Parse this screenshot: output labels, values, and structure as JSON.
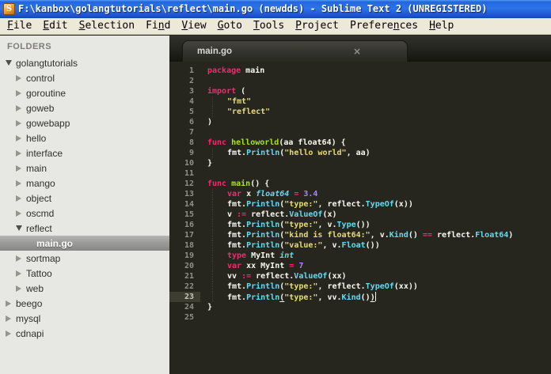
{
  "window": {
    "title": "F:\\kanbox\\golangtutorials\\reflect\\main.go (newdds) - Sublime Text 2 (UNREGISTERED)"
  },
  "menu": {
    "items": [
      {
        "label": "File",
        "underline": 0
      },
      {
        "label": "Edit",
        "underline": 0
      },
      {
        "label": "Selection",
        "underline": 0
      },
      {
        "label": "Find",
        "underline": 2
      },
      {
        "label": "View",
        "underline": 0
      },
      {
        "label": "Goto",
        "underline": 0
      },
      {
        "label": "Tools",
        "underline": 0
      },
      {
        "label": "Project",
        "underline": 0
      },
      {
        "label": "Preferences",
        "underline": 7
      },
      {
        "label": "Help",
        "underline": 0
      }
    ]
  },
  "sidebar": {
    "header": "FOLDERS",
    "tree": [
      {
        "label": "golangtutorials",
        "level": 0,
        "state": "open",
        "selected": false
      },
      {
        "label": "control",
        "level": 1,
        "state": "closed",
        "selected": false
      },
      {
        "label": "goroutine",
        "level": 1,
        "state": "closed",
        "selected": false
      },
      {
        "label": "goweb",
        "level": 1,
        "state": "closed",
        "selected": false
      },
      {
        "label": "gowebapp",
        "level": 1,
        "state": "closed",
        "selected": false
      },
      {
        "label": "hello",
        "level": 1,
        "state": "closed",
        "selected": false
      },
      {
        "label": "interface",
        "level": 1,
        "state": "closed",
        "selected": false
      },
      {
        "label": "main",
        "level": 1,
        "state": "closed",
        "selected": false
      },
      {
        "label": "mango",
        "level": 1,
        "state": "closed",
        "selected": false
      },
      {
        "label": "object",
        "level": 1,
        "state": "closed",
        "selected": false
      },
      {
        "label": "oscmd",
        "level": 1,
        "state": "closed",
        "selected": false
      },
      {
        "label": "reflect",
        "level": 1,
        "state": "open",
        "selected": false
      },
      {
        "label": "main.go",
        "level": 2,
        "state": "file",
        "selected": true
      },
      {
        "label": "sortmap",
        "level": 1,
        "state": "closed",
        "selected": false
      },
      {
        "label": "Tattoo",
        "level": 1,
        "state": "closed",
        "selected": false
      },
      {
        "label": "web",
        "level": 1,
        "state": "closed",
        "selected": false
      },
      {
        "label": "beego",
        "level": 0,
        "state": "closed",
        "selected": false
      },
      {
        "label": "mysql",
        "level": 0,
        "state": "closed",
        "selected": false
      },
      {
        "label": "cdnapi",
        "level": 0,
        "state": "closed",
        "selected": false
      }
    ]
  },
  "tab": {
    "label": "main.go",
    "close": "×"
  },
  "editor": {
    "active_line": 23,
    "lines": [
      {
        "num": 1,
        "ind": 0,
        "tokens": [
          [
            "k",
            "package"
          ],
          [
            "w",
            " main"
          ]
        ]
      },
      {
        "num": 2,
        "ind": 0,
        "tokens": []
      },
      {
        "num": 3,
        "ind": 0,
        "tokens": [
          [
            "k",
            "import"
          ],
          [
            "w",
            " ("
          ]
        ]
      },
      {
        "num": 4,
        "ind": 1,
        "tokens": [
          [
            "s",
            "\"fmt\""
          ]
        ]
      },
      {
        "num": 5,
        "ind": 1,
        "tokens": [
          [
            "s",
            "\"reflect\""
          ]
        ]
      },
      {
        "num": 6,
        "ind": 0,
        "tokens": [
          [
            "w",
            ")"
          ]
        ]
      },
      {
        "num": 7,
        "ind": 0,
        "tokens": []
      },
      {
        "num": 8,
        "ind": 0,
        "tokens": [
          [
            "k",
            "func"
          ],
          [
            "w",
            " "
          ],
          [
            "g",
            "helloworld"
          ],
          [
            "w",
            "(aa float64) {"
          ]
        ]
      },
      {
        "num": 9,
        "ind": 1,
        "tokens": [
          [
            "w",
            "fmt."
          ],
          [
            "c",
            "Println"
          ],
          [
            "w",
            "("
          ],
          [
            "s",
            "\"hello world\""
          ],
          [
            "w",
            ", aa)"
          ]
        ]
      },
      {
        "num": 10,
        "ind": 0,
        "tokens": [
          [
            "w",
            "}"
          ]
        ]
      },
      {
        "num": 11,
        "ind": 0,
        "tokens": []
      },
      {
        "num": 12,
        "ind": 0,
        "tokens": [
          [
            "k",
            "func"
          ],
          [
            "w",
            " "
          ],
          [
            "g",
            "main"
          ],
          [
            "w",
            "() {"
          ]
        ]
      },
      {
        "num": 13,
        "ind": 1,
        "tokens": [
          [
            "k",
            "var"
          ],
          [
            "w",
            " x "
          ],
          [
            "t",
            "float64"
          ],
          [
            "w",
            " "
          ],
          [
            "k",
            "="
          ],
          [
            "w",
            " "
          ],
          [
            "n",
            "3.4"
          ]
        ]
      },
      {
        "num": 14,
        "ind": 1,
        "tokens": [
          [
            "w",
            "fmt."
          ],
          [
            "c",
            "Println"
          ],
          [
            "w",
            "("
          ],
          [
            "s",
            "\"type:\""
          ],
          [
            "w",
            ", reflect."
          ],
          [
            "c",
            "TypeOf"
          ],
          [
            "w",
            "(x))"
          ]
        ]
      },
      {
        "num": 15,
        "ind": 1,
        "tokens": [
          [
            "w",
            "v "
          ],
          [
            "k",
            ":="
          ],
          [
            "w",
            " reflect."
          ],
          [
            "c",
            "ValueOf"
          ],
          [
            "w",
            "(x)"
          ]
        ]
      },
      {
        "num": 16,
        "ind": 1,
        "tokens": [
          [
            "w",
            "fmt."
          ],
          [
            "c",
            "Println"
          ],
          [
            "w",
            "("
          ],
          [
            "s",
            "\"type:\""
          ],
          [
            "w",
            ", v."
          ],
          [
            "c",
            "Type"
          ],
          [
            "w",
            "())"
          ]
        ]
      },
      {
        "num": 17,
        "ind": 1,
        "tokens": [
          [
            "w",
            "fmt."
          ],
          [
            "c",
            "Println"
          ],
          [
            "w",
            "("
          ],
          [
            "s",
            "\"kind is float64:\""
          ],
          [
            "w",
            ", v."
          ],
          [
            "c",
            "Kind"
          ],
          [
            "w",
            "() "
          ],
          [
            "k",
            "=="
          ],
          [
            "w",
            " reflect."
          ],
          [
            "c",
            "Float64"
          ],
          [
            "w",
            ")"
          ]
        ]
      },
      {
        "num": 18,
        "ind": 1,
        "tokens": [
          [
            "w",
            "fmt."
          ],
          [
            "c",
            "Println"
          ],
          [
            "w",
            "("
          ],
          [
            "s",
            "\"value:\""
          ],
          [
            "w",
            ", v."
          ],
          [
            "c",
            "Float"
          ],
          [
            "w",
            "())"
          ]
        ]
      },
      {
        "num": 19,
        "ind": 1,
        "tokens": [
          [
            "k",
            "type"
          ],
          [
            "w",
            " MyInt "
          ],
          [
            "t",
            "int"
          ]
        ]
      },
      {
        "num": 20,
        "ind": 1,
        "tokens": [
          [
            "k",
            "var"
          ],
          [
            "w",
            " xx MyInt "
          ],
          [
            "k",
            "="
          ],
          [
            "w",
            " "
          ],
          [
            "n",
            "7"
          ]
        ]
      },
      {
        "num": 21,
        "ind": 1,
        "tokens": [
          [
            "w",
            "vv "
          ],
          [
            "k",
            ":="
          ],
          [
            "w",
            " reflect."
          ],
          [
            "c",
            "ValueOf"
          ],
          [
            "w",
            "(xx)"
          ]
        ]
      },
      {
        "num": 22,
        "ind": 1,
        "tokens": [
          [
            "w",
            "fmt."
          ],
          [
            "c",
            "Println"
          ],
          [
            "w",
            "("
          ],
          [
            "s",
            "\"type:\""
          ],
          [
            "w",
            ", reflect."
          ],
          [
            "c",
            "TypeOf"
          ],
          [
            "w",
            "(xx))"
          ]
        ]
      },
      {
        "num": 23,
        "ind": 1,
        "cursor": true,
        "tokens": [
          [
            "w",
            "fmt."
          ],
          [
            "c",
            "Println"
          ],
          [
            "u",
            "("
          ],
          [
            "s",
            "\"type:\""
          ],
          [
            "w",
            ", vv."
          ],
          [
            "c",
            "Kind"
          ],
          [
            "w",
            "()"
          ],
          [
            "u",
            ")"
          ]
        ]
      },
      {
        "num": 24,
        "ind": 0,
        "tokens": [
          [
            "w",
            "}"
          ]
        ]
      },
      {
        "num": 25,
        "ind": 0,
        "tokens": []
      }
    ]
  },
  "colors": {
    "editor_bg": "#26261f",
    "foreground": "#f8f8f2",
    "keyword": "#f92672",
    "string": "#e6db74",
    "function_name": "#a6e22e",
    "support_function": "#66d9ef",
    "number": "#ae81ff",
    "line_number": "#8f908a",
    "titlebar_blue": "#2e74e8",
    "menu_bg": "#ece9d8",
    "sidebar_bg": "#e7e7e3"
  }
}
